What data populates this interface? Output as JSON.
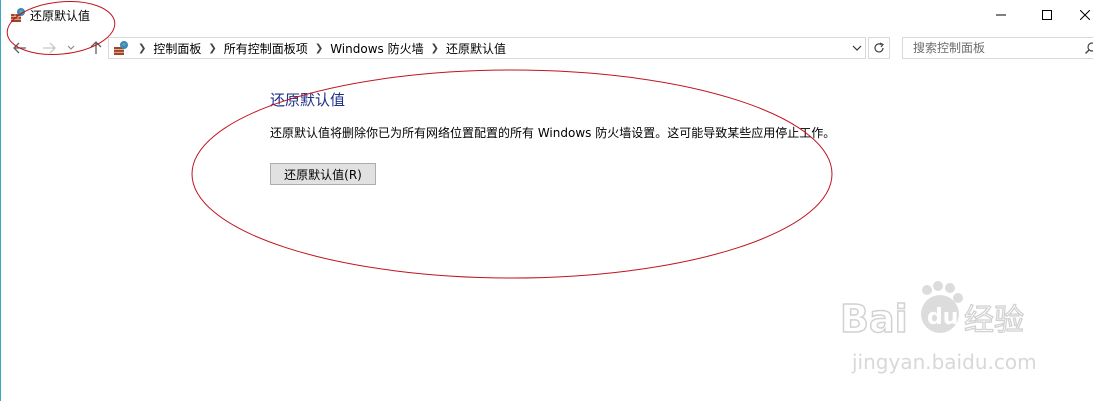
{
  "window": {
    "title": "还原默认值",
    "minimize_icon": "minimize-icon",
    "maximize_icon": "maximize-icon",
    "close_icon": "close-icon"
  },
  "address_bar": {
    "breadcrumbs": [
      "控制面板",
      "所有控制面板项",
      "Windows 防火墙",
      "还原默认值"
    ],
    "search_placeholder": "搜索控制面板"
  },
  "content": {
    "heading": "还原默认值",
    "description": "还原默认值将删除你已为所有网络位置配置的所有 Windows 防火墙设置。这可能导致某些应用停止工作。",
    "restore_button_label": "还原默认值(R)"
  },
  "watermark": {
    "brand_text": "Bai du 经验",
    "url": "jingyan.baidu.com"
  },
  "colors": {
    "heading": "#1e3287",
    "annotation": "#c0141e",
    "button_bg": "#e1e1e1"
  }
}
